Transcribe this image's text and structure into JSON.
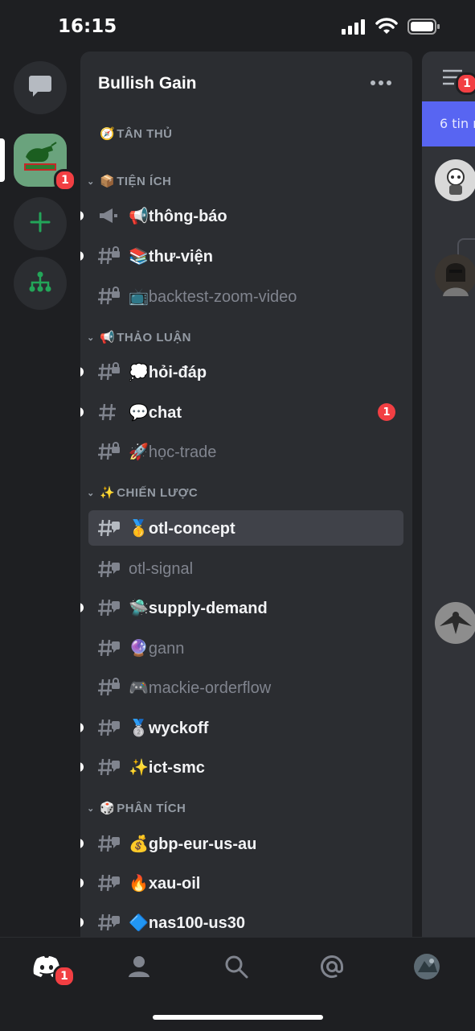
{
  "status": {
    "time": "16:15"
  },
  "rail": {
    "server_badge": "1"
  },
  "server": {
    "name": "Bullish Gain"
  },
  "categories": [
    {
      "emoji": "🧭",
      "name": "TÂN THỦ",
      "collapsed": true
    },
    {
      "emoji": "📦",
      "name": "TIỆN ÍCH"
    },
    {
      "emoji": "📢",
      "name": "THẢO LUẬN"
    },
    {
      "emoji": "✨",
      "name": "CHIẾN LƯỢC"
    },
    {
      "emoji": "🎲",
      "name": "PHÂN TÍCH"
    }
  ],
  "channels": [
    {
      "label": "📢thông-báo",
      "unread": true,
      "type": "announce"
    },
    {
      "label": "📚thư-viện",
      "unread": true,
      "type": "locked"
    },
    {
      "label": "📺backtest-zoom-video",
      "unread": false,
      "type": "locked"
    },
    {
      "label": "💭hỏi-đáp",
      "unread": true,
      "type": "locked"
    },
    {
      "label": "💬chat",
      "unread": true,
      "type": "text",
      "badge": "1"
    },
    {
      "label": "🚀học-trade",
      "unread": false,
      "type": "locked"
    },
    {
      "label": "🥇otl-concept",
      "unread": false,
      "active": true,
      "type": "thread"
    },
    {
      "label": "otl-signal",
      "unread": false,
      "type": "thread"
    },
    {
      "label": "🛸supply-demand",
      "unread": true,
      "type": "thread"
    },
    {
      "label": "🔮gann",
      "unread": false,
      "type": "thread"
    },
    {
      "label": "🎮mackie-orderflow",
      "unread": false,
      "type": "locked"
    },
    {
      "label": "🥈wyckoff",
      "unread": true,
      "type": "thread"
    },
    {
      "label": "✨ict-smc",
      "unread": true,
      "type": "thread"
    },
    {
      "label": "💰gbp-eur-us-au",
      "unread": true,
      "type": "thread"
    },
    {
      "label": "🔥xau-oil",
      "unread": true,
      "type": "thread"
    },
    {
      "label": "🔷nas100-us30",
      "unread": true,
      "type": "thread"
    }
  ],
  "peek": {
    "banner_text": "6 tin n",
    "members_badge": "1"
  },
  "bottom_nav": {
    "home_badge": "1"
  },
  "colors": {
    "accent": "#5865f2",
    "badge": "#f23f43",
    "green": "#23a559"
  }
}
